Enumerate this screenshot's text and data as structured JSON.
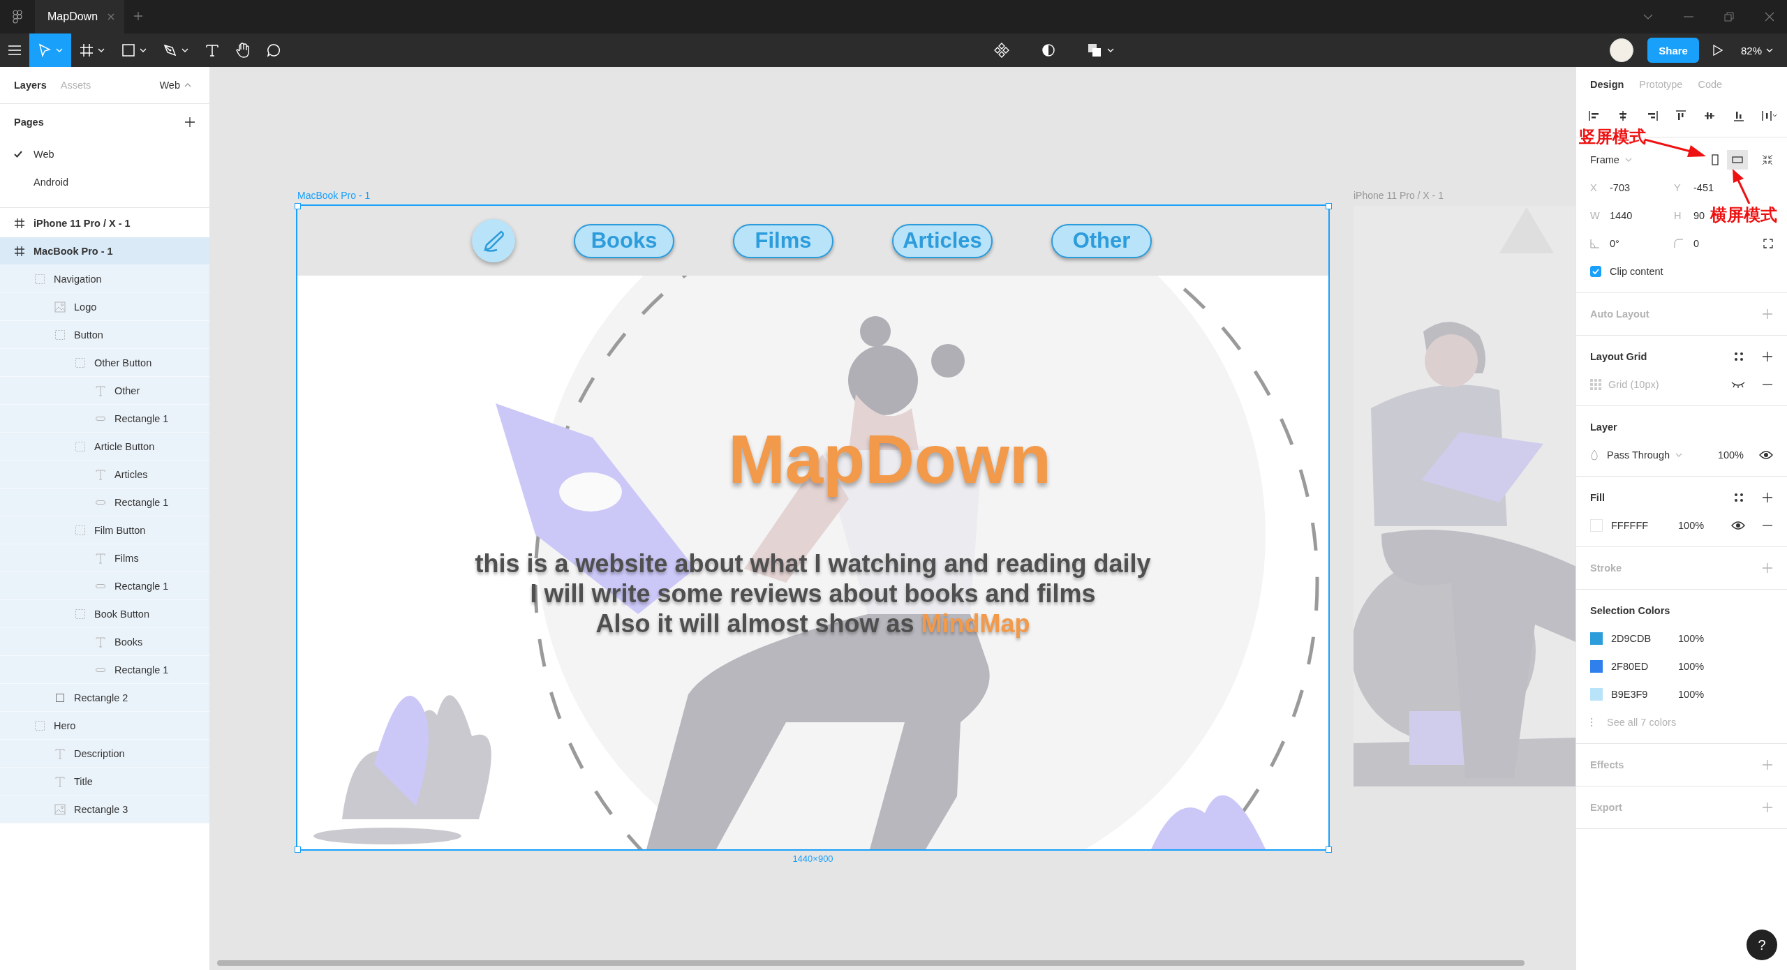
{
  "title_bar": {
    "tabs": [
      {
        "label": "MapDown",
        "selected": true
      }
    ]
  },
  "toolbar": {
    "tools": [
      {
        "kind": "move",
        "selected": true,
        "caret": true
      },
      {
        "kind": "frame",
        "selected": false,
        "caret": true
      },
      {
        "kind": "rectangle",
        "selected": false,
        "caret": true
      },
      {
        "kind": "pen",
        "selected": false,
        "caret": true
      },
      {
        "kind": "text",
        "selected": false,
        "caret": false
      },
      {
        "kind": "hand",
        "selected": false,
        "caret": false
      },
      {
        "kind": "comment",
        "selected": false,
        "caret": false
      }
    ],
    "center_tools": [
      {
        "kind": "component"
      },
      {
        "kind": "mask"
      },
      {
        "kind": "boolean"
      }
    ],
    "share": "Share",
    "zoom": "82%"
  },
  "left_panel": {
    "tabs": [
      {
        "label": "Layers",
        "selected": true
      },
      {
        "label": "Assets",
        "selected": false
      }
    ],
    "page_switcher": "Web",
    "pages_title": "Pages",
    "pages": [
      {
        "label": "Web",
        "selected": true
      },
      {
        "label": "Android",
        "selected": false
      }
    ],
    "layers": [
      {
        "name": "iPhone 11 Pro / X - 1",
        "kind": "frame",
        "selected": false
      },
      {
        "name": "MacBook Pro - 1",
        "kind": "frame",
        "selected": true,
        "children": [
          {
            "name": "Navigation",
            "kind": "group",
            "selected": false,
            "children": [
              {
                "name": "Logo",
                "kind": "image",
                "selected": false
              },
              {
                "name": "Button",
                "kind": "group",
                "selected": false,
                "children": [
                  {
                    "name": "Other Button",
                    "kind": "group",
                    "selected": false,
                    "children": [
                      {
                        "name": "Other",
                        "kind": "text",
                        "selected": false
                      },
                      {
                        "name": "Rectangle 1",
                        "kind": "pill",
                        "selected": false
                      }
                    ]
                  },
                  {
                    "name": "Article Button",
                    "kind": "group",
                    "selected": false,
                    "children": [
                      {
                        "name": "Articles",
                        "kind": "text",
                        "selected": false
                      },
                      {
                        "name": "Rectangle 1",
                        "kind": "pill",
                        "selected": false
                      }
                    ]
                  },
                  {
                    "name": "Film Button",
                    "kind": "group",
                    "selected": false,
                    "children": [
                      {
                        "name": "Films",
                        "kind": "text",
                        "selected": false
                      },
                      {
                        "name": "Rectangle 1",
                        "kind": "pill",
                        "selected": false
                      }
                    ]
                  },
                  {
                    "name": "Book Button",
                    "kind": "group",
                    "selected": false,
                    "children": [
                      {
                        "name": "Books",
                        "kind": "text",
                        "selected": false
                      },
                      {
                        "name": "Rectangle 1",
                        "kind": "pill",
                        "selected": false
                      }
                    ]
                  }
                ]
              },
              {
                "name": "Rectangle 2",
                "kind": "rectangle",
                "selected": false
              }
            ]
          },
          {
            "name": "Hero",
            "kind": "group",
            "selected": false,
            "children": [
              {
                "name": "Description",
                "kind": "text",
                "selected": false
              },
              {
                "name": "Title",
                "kind": "text",
                "selected": false
              },
              {
                "name": "Rectangle 3",
                "kind": "image",
                "selected": false
              }
            ]
          }
        ]
      }
    ]
  },
  "canvas": {
    "main_frame": {
      "label": "MacBook Pro - 1",
      "selected": true,
      "size": "1440×900",
      "nav_buttons": [
        "Books",
        "Films",
        "Articles",
        "Other"
      ],
      "title": "MapDown",
      "description": [
        {
          "text": "this is a website about what I watching and reading daily"
        },
        {
          "text": "I will write some reviews about books and films"
        },
        {
          "text": "Also it will almost show as ",
          "highlight": "MindMap"
        }
      ]
    },
    "side_frame": {
      "label": "iPhone 11 Pro / X - 1",
      "selected": false
    }
  },
  "right_panel": {
    "tabs": [
      {
        "label": "Design",
        "selected": true
      },
      {
        "label": "Prototype",
        "selected": false
      },
      {
        "label": "Code",
        "selected": false
      }
    ],
    "frame_preset": "Frame",
    "orientations": [
      {
        "kind": "portrait",
        "selected": false
      },
      {
        "kind": "landscape",
        "selected": true
      }
    ],
    "fields": [
      {
        "kind": "labeled",
        "label": "X",
        "value": "-703"
      },
      {
        "kind": "labeled",
        "label": "Y",
        "value": "-451"
      },
      {
        "kind": "labeled",
        "label": "W",
        "value": "1440"
      },
      {
        "kind": "labeled",
        "label": "H",
        "value": "90"
      },
      {
        "kind": "rotation",
        "value": "0°"
      },
      {
        "kind": "radius",
        "value": "0"
      }
    ],
    "clip_content": {
      "label": "Clip content",
      "checked": true
    },
    "sections": [
      {
        "kind": "auto_layout",
        "title": "Auto Layout",
        "empty": true
      },
      {
        "kind": "layout_grid",
        "title": "Layout Grid",
        "empty": false,
        "grid": "Grid (10px)",
        "visible": false
      },
      {
        "kind": "layer",
        "title": "Layer",
        "empty": false,
        "blend": "Pass Through",
        "opacity": "100%"
      },
      {
        "kind": "fill",
        "title": "Fill",
        "empty": false,
        "color": "#ffffff",
        "hex": "FFFFFF",
        "opacity": "100%"
      },
      {
        "kind": "stroke",
        "title": "Stroke",
        "empty": true
      },
      {
        "kind": "selection_colors",
        "title": "Selection Colors",
        "empty": false,
        "colors": [
          {
            "color": "#2d9cdb",
            "hex": "2D9CDB",
            "opacity": "100%"
          },
          {
            "color": "#2f80ed",
            "hex": "2F80ED",
            "opacity": "100%"
          },
          {
            "color": "#b9e3f9",
            "hex": "B9E3F9",
            "opacity": "100%"
          }
        ],
        "see_all": "See all 7 colors"
      },
      {
        "kind": "effects",
        "title": "Effects",
        "empty": true
      },
      {
        "kind": "export",
        "title": "Export",
        "empty": true
      }
    ],
    "annotations": [
      {
        "text": "竖屏模式"
      },
      {
        "text": "横屏模式"
      }
    ],
    "help": "?"
  }
}
